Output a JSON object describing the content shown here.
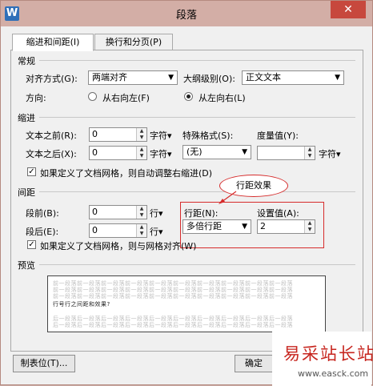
{
  "window": {
    "title": "段落",
    "app_icon": "W",
    "close_label": "✕"
  },
  "tabs": [
    {
      "label": "缩进和间距(I)"
    },
    {
      "label": "换行和分页(P)"
    }
  ],
  "general": {
    "section_label": "常规",
    "alignment_label": "对齐方式(G):",
    "alignment_value": "两端对齐",
    "outline_label": "大纲级别(O):",
    "outline_value": "正文文本",
    "direction_label": "方向:",
    "rtl_label": "从右向左(F)",
    "ltr_label": "从左向右(L)",
    "direction_selected": "ltr"
  },
  "indent": {
    "section_label": "缩进",
    "before_label": "文本之前(R):",
    "before_value": "0",
    "before_unit": "字符▾",
    "after_label": "文本之后(X):",
    "after_value": "0",
    "after_unit": "字符▾",
    "special_label": "特殊格式(S):",
    "special_value": "(无)",
    "measure_label": "度量值(Y):",
    "measure_value": "",
    "measure_unit": "字符▾",
    "auto_adjust_label": "如果定义了文档网格，则自动调整右缩进(D)",
    "auto_adjust_checked": true
  },
  "spacing": {
    "section_label": "间距",
    "before_label": "段前(B):",
    "before_value": "0",
    "before_unit": "行▾",
    "after_label": "段后(E):",
    "after_value": "0",
    "after_unit": "行▾",
    "line_label": "行距(N):",
    "line_value": "多倍行距",
    "setting_label": "设置值(A):",
    "setting_value": "2",
    "snap_label": "如果定义了文档网格，则与网格对齐(W)",
    "snap_checked": true
  },
  "annotation": {
    "callout_text": "行距效果"
  },
  "preview": {
    "section_label": "预览",
    "gray_line": "前一段落前一段落前一段落前一段落前一段落前一段落前一段落前一段落前一段落前一段落",
    "sample_line": "行号行之间距和效果?",
    "next_line": "后一段落后一段落后一段落后一段落后一段落后一段落后一段落后一段落后一段落后一段落"
  },
  "buttons": {
    "tabs_label": "制表位(T)...",
    "ok_label": "确定"
  },
  "watermark": {
    "big": "易采站长站",
    "small": "www.easck.com"
  }
}
